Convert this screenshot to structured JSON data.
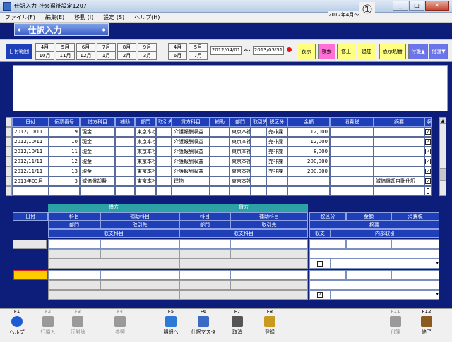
{
  "window": {
    "title": "仕訳入力 社会福祉設定1207",
    "buttons": [
      "_",
      "□",
      "✕"
    ]
  },
  "menu": [
    "ファイル(F)",
    "編集(E)",
    "移動 (I)",
    "設定 (S)",
    "ヘルプ(H)"
  ],
  "screen_title": "仕訳入力",
  "period_label": "2012年4月～3月",
  "annotation_number": "①",
  "toolbar": {
    "date_range_btn": "日付範囲",
    "months_a_top": [
      "4月",
      "5月",
      "6月",
      "7月",
      "8月",
      "9月"
    ],
    "months_a_bottom": [
      "10月",
      "11月",
      "12月",
      "1月",
      "2月",
      "3月"
    ],
    "months_b_top": [
      "4月",
      "5月"
    ],
    "months_b_bottom": [
      "6月",
      "7月"
    ],
    "date_from": "2012/04/01",
    "tilde": "～",
    "date_to": "2013/03/31",
    "show": "表示",
    "search": "検索",
    "modify": "修正",
    "add": "追加",
    "toggle_view": "表示切替",
    "attach_up": "付箋▲",
    "attach_down": "付箋▼"
  },
  "table": {
    "headers": [
      "日付",
      "伝票番号",
      "借方科目",
      "補助",
      "部門",
      "取引先",
      "貸方科目",
      "補助",
      "部門",
      "取引先",
      "税区分",
      "金額",
      "消費税",
      "摘要",
      "収"
    ],
    "rows": [
      [
        "2012/10/11",
        "9",
        "現金",
        "",
        "東京本社",
        "",
        "介護報酬収益",
        "",
        "東京本社",
        "",
        "売非課",
        "12,000",
        "",
        "",
        "✓"
      ],
      [
        "2012/10/11",
        "10",
        "現金",
        "",
        "東京本社",
        "",
        "介護報酬収益",
        "",
        "東京本社",
        "",
        "売非課",
        "12,000",
        "",
        "",
        "✓"
      ],
      [
        "2012/10/11",
        "11",
        "現金",
        "",
        "東京本社",
        "",
        "介護報酬収益",
        "",
        "東京本社",
        "",
        "売非課",
        "8,000",
        "",
        "",
        "✓"
      ],
      [
        "2012/11/11",
        "12",
        "現金",
        "",
        "東京本社",
        "",
        "介護報酬収益",
        "",
        "東京本社",
        "",
        "売非課",
        "200,000",
        "",
        "",
        "✓"
      ],
      [
        "2012/11/11",
        "13",
        "現金",
        "",
        "東京本社",
        "",
        "介護報酬収益",
        "",
        "東京本社",
        "",
        "売非課",
        "200,000",
        "",
        "",
        "✓"
      ],
      [
        "2013年03月",
        "3",
        "減価償却費",
        "",
        "東京本社",
        "",
        "建物",
        "",
        "東京本社",
        "",
        "",
        "",
        "",
        "減価償却自動仕訳",
        "✓"
      ],
      [
        "",
        "",
        "",
        "",
        "",
        "",
        "",
        "",
        "",
        "",
        "",
        "",
        "",
        "",
        ""
      ]
    ]
  },
  "entry": {
    "date_label": "日付",
    "debit": "借方",
    "credit": "貸方",
    "account": "科目",
    "sub_account": "補助科目",
    "dept": "部門",
    "partner": "取引先",
    "income_account": "収支科目",
    "tax_category": "税区分",
    "amount": "金額",
    "consumption_tax": "消費税",
    "summary": "摘要",
    "income_exp": "収支",
    "internal": "内部取引"
  },
  "fkeys": [
    {
      "key": "F1",
      "label": "ヘルプ",
      "icon": "help-icon",
      "enabled": true
    },
    {
      "key": "F2",
      "label": "行挿入",
      "icon": "insert-row-icon",
      "enabled": false
    },
    {
      "key": "F3",
      "label": "行削除",
      "icon": "delete-row-icon",
      "enabled": false
    },
    {
      "key": "F4",
      "label": "参照",
      "icon": "reference-icon",
      "enabled": false
    },
    {
      "key": "F5",
      "label": "明細へ",
      "icon": "detail-icon",
      "enabled": true
    },
    {
      "key": "F6",
      "label": "仕訳マスタ",
      "icon": "magnifier-icon",
      "enabled": true
    },
    {
      "key": "F7",
      "label": "取消",
      "icon": "trash-icon",
      "enabled": true
    },
    {
      "key": "F8",
      "label": "登録",
      "icon": "register-icon",
      "enabled": true
    },
    {
      "key": "F11",
      "label": "付箋",
      "icon": "tag-icon",
      "enabled": false
    },
    {
      "key": "F12",
      "label": "終了",
      "icon": "exit-door-icon",
      "enabled": true
    }
  ]
}
